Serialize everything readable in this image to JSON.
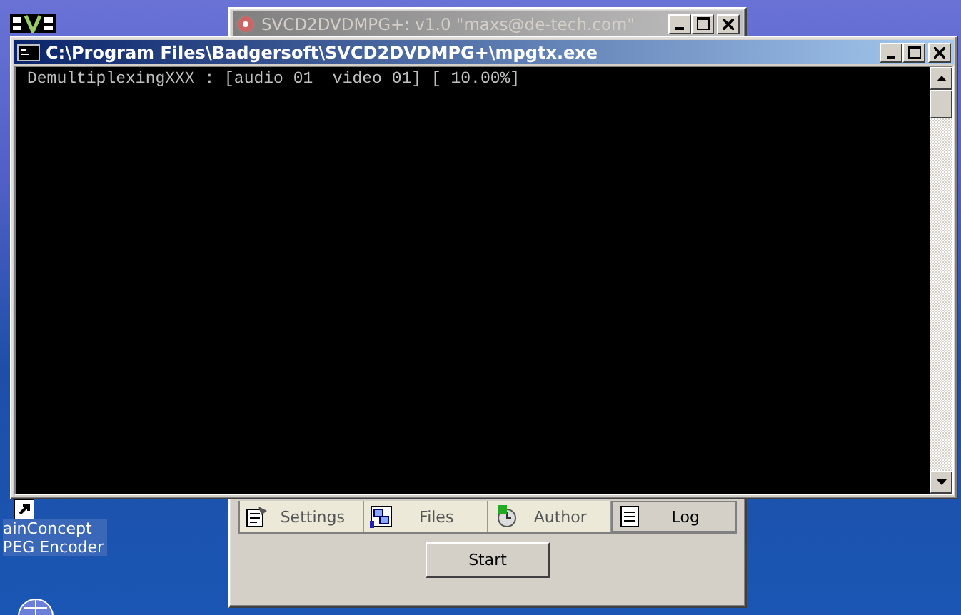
{
  "desktop": {
    "icons": [
      {
        "label": "ainConcept\nPEG Encoder",
        "selected": true
      }
    ]
  },
  "back_window": {
    "title": "SVCD2DVDMPG+: v1.0 \"maxs@de-tech.com\"",
    "active": false,
    "tabs": [
      {
        "label": "Settings",
        "kind": "settings",
        "selected": false
      },
      {
        "label": "Files",
        "kind": "files",
        "selected": false
      },
      {
        "label": "Author",
        "kind": "author",
        "selected": false
      },
      {
        "label": "Log",
        "kind": "log",
        "selected": true
      }
    ],
    "start_button": "Start"
  },
  "console": {
    "title": "C:\\Program Files\\Badgersoft\\SVCD2DVDMPG+\\mpgtx.exe",
    "active": true,
    "lines": [
      "DemultiplexingXXX : [audio 01  video 01] [ 10.00%]"
    ]
  }
}
